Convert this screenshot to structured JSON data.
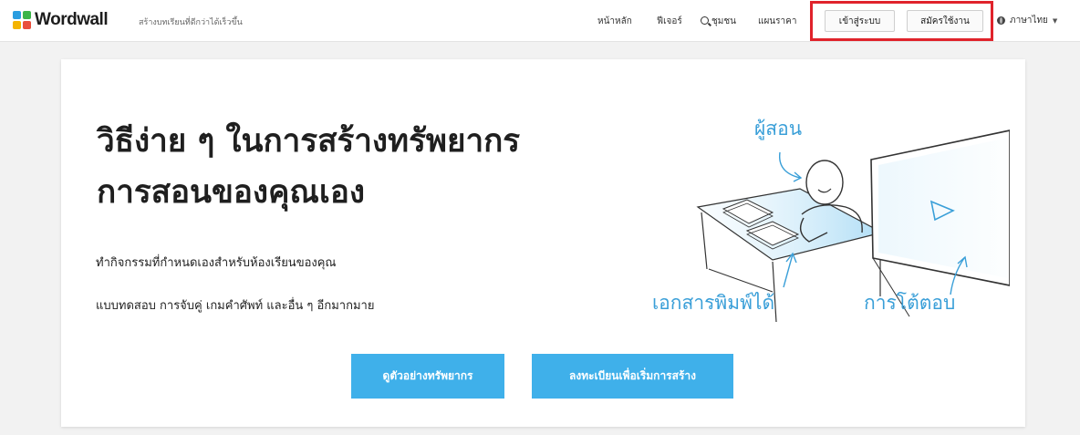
{
  "header": {
    "logo_text": "Wordwall",
    "tagline": "สร้างบทเรียนที่ดีกว่าได้เร็วขึ้น",
    "nav": {
      "home": "หน้าหลัก",
      "features": "ฟีเจอร์",
      "community": "ชุมชน",
      "pricing": "แผนราคา"
    },
    "login_label": "เข้าสู่ระบบ",
    "signup_label": "สมัครใช้งาน",
    "language_label": "ภาษาไทย",
    "logo_colors": [
      "#2a9de0",
      "#3cb54a",
      "#f4b400",
      "#e94e3c"
    ]
  },
  "hero": {
    "headline_line1": "วิธีง่าย ๆ ในการสร้างทรัพยากร",
    "headline_line2": "การสอนของคุณเอง",
    "subline1": "ทำกิจกรรมที่กำหนดเองสำหรับห้องเรียนของคุณ",
    "subline2": "แบบทดสอบ การจับคู่ เกมคำศัพท์ และอื่น ๆ อีกมากมาย",
    "cta_examples": "ดูตัวอย่างทรัพยากร",
    "cta_signup": "ลงทะเบียนเพื่อเริ่มการสร้าง",
    "accent_color": "#3fb0ea",
    "highlight_color": "#e0232b"
  },
  "illustration": {
    "label_teacher": "ผู้สอน",
    "label_printables": "เอกสารพิมพ์ได้",
    "label_interactive": "การโต้ตอบ"
  }
}
